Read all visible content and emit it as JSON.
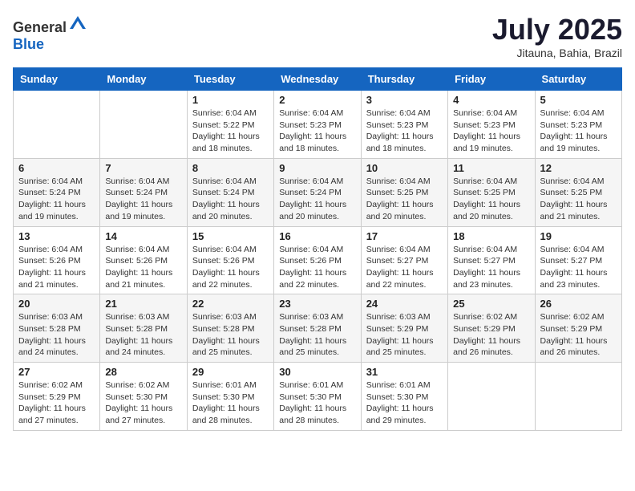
{
  "header": {
    "logo_general": "General",
    "logo_blue": "Blue",
    "month_title": "July 2025",
    "location": "Jitauna, Bahia, Brazil"
  },
  "days_of_week": [
    "Sunday",
    "Monday",
    "Tuesday",
    "Wednesday",
    "Thursday",
    "Friday",
    "Saturday"
  ],
  "weeks": [
    [
      {
        "day": "",
        "sunrise": "",
        "sunset": "",
        "daylight": ""
      },
      {
        "day": "",
        "sunrise": "",
        "sunset": "",
        "daylight": ""
      },
      {
        "day": "1",
        "sunrise": "Sunrise: 6:04 AM",
        "sunset": "Sunset: 5:22 PM",
        "daylight": "Daylight: 11 hours and 18 minutes."
      },
      {
        "day": "2",
        "sunrise": "Sunrise: 6:04 AM",
        "sunset": "Sunset: 5:23 PM",
        "daylight": "Daylight: 11 hours and 18 minutes."
      },
      {
        "day": "3",
        "sunrise": "Sunrise: 6:04 AM",
        "sunset": "Sunset: 5:23 PM",
        "daylight": "Daylight: 11 hours and 18 minutes."
      },
      {
        "day": "4",
        "sunrise": "Sunrise: 6:04 AM",
        "sunset": "Sunset: 5:23 PM",
        "daylight": "Daylight: 11 hours and 19 minutes."
      },
      {
        "day": "5",
        "sunrise": "Sunrise: 6:04 AM",
        "sunset": "Sunset: 5:23 PM",
        "daylight": "Daylight: 11 hours and 19 minutes."
      }
    ],
    [
      {
        "day": "6",
        "sunrise": "Sunrise: 6:04 AM",
        "sunset": "Sunset: 5:24 PM",
        "daylight": "Daylight: 11 hours and 19 minutes."
      },
      {
        "day": "7",
        "sunrise": "Sunrise: 6:04 AM",
        "sunset": "Sunset: 5:24 PM",
        "daylight": "Daylight: 11 hours and 19 minutes."
      },
      {
        "day": "8",
        "sunrise": "Sunrise: 6:04 AM",
        "sunset": "Sunset: 5:24 PM",
        "daylight": "Daylight: 11 hours and 20 minutes."
      },
      {
        "day": "9",
        "sunrise": "Sunrise: 6:04 AM",
        "sunset": "Sunset: 5:24 PM",
        "daylight": "Daylight: 11 hours and 20 minutes."
      },
      {
        "day": "10",
        "sunrise": "Sunrise: 6:04 AM",
        "sunset": "Sunset: 5:25 PM",
        "daylight": "Daylight: 11 hours and 20 minutes."
      },
      {
        "day": "11",
        "sunrise": "Sunrise: 6:04 AM",
        "sunset": "Sunset: 5:25 PM",
        "daylight": "Daylight: 11 hours and 20 minutes."
      },
      {
        "day": "12",
        "sunrise": "Sunrise: 6:04 AM",
        "sunset": "Sunset: 5:25 PM",
        "daylight": "Daylight: 11 hours and 21 minutes."
      }
    ],
    [
      {
        "day": "13",
        "sunrise": "Sunrise: 6:04 AM",
        "sunset": "Sunset: 5:26 PM",
        "daylight": "Daylight: 11 hours and 21 minutes."
      },
      {
        "day": "14",
        "sunrise": "Sunrise: 6:04 AM",
        "sunset": "Sunset: 5:26 PM",
        "daylight": "Daylight: 11 hours and 21 minutes."
      },
      {
        "day": "15",
        "sunrise": "Sunrise: 6:04 AM",
        "sunset": "Sunset: 5:26 PM",
        "daylight": "Daylight: 11 hours and 22 minutes."
      },
      {
        "day": "16",
        "sunrise": "Sunrise: 6:04 AM",
        "sunset": "Sunset: 5:26 PM",
        "daylight": "Daylight: 11 hours and 22 minutes."
      },
      {
        "day": "17",
        "sunrise": "Sunrise: 6:04 AM",
        "sunset": "Sunset: 5:27 PM",
        "daylight": "Daylight: 11 hours and 22 minutes."
      },
      {
        "day": "18",
        "sunrise": "Sunrise: 6:04 AM",
        "sunset": "Sunset: 5:27 PM",
        "daylight": "Daylight: 11 hours and 23 minutes."
      },
      {
        "day": "19",
        "sunrise": "Sunrise: 6:04 AM",
        "sunset": "Sunset: 5:27 PM",
        "daylight": "Daylight: 11 hours and 23 minutes."
      }
    ],
    [
      {
        "day": "20",
        "sunrise": "Sunrise: 6:03 AM",
        "sunset": "Sunset: 5:28 PM",
        "daylight": "Daylight: 11 hours and 24 minutes."
      },
      {
        "day": "21",
        "sunrise": "Sunrise: 6:03 AM",
        "sunset": "Sunset: 5:28 PM",
        "daylight": "Daylight: 11 hours and 24 minutes."
      },
      {
        "day": "22",
        "sunrise": "Sunrise: 6:03 AM",
        "sunset": "Sunset: 5:28 PM",
        "daylight": "Daylight: 11 hours and 25 minutes."
      },
      {
        "day": "23",
        "sunrise": "Sunrise: 6:03 AM",
        "sunset": "Sunset: 5:28 PM",
        "daylight": "Daylight: 11 hours and 25 minutes."
      },
      {
        "day": "24",
        "sunrise": "Sunrise: 6:03 AM",
        "sunset": "Sunset: 5:29 PM",
        "daylight": "Daylight: 11 hours and 25 minutes."
      },
      {
        "day": "25",
        "sunrise": "Sunrise: 6:02 AM",
        "sunset": "Sunset: 5:29 PM",
        "daylight": "Daylight: 11 hours and 26 minutes."
      },
      {
        "day": "26",
        "sunrise": "Sunrise: 6:02 AM",
        "sunset": "Sunset: 5:29 PM",
        "daylight": "Daylight: 11 hours and 26 minutes."
      }
    ],
    [
      {
        "day": "27",
        "sunrise": "Sunrise: 6:02 AM",
        "sunset": "Sunset: 5:29 PM",
        "daylight": "Daylight: 11 hours and 27 minutes."
      },
      {
        "day": "28",
        "sunrise": "Sunrise: 6:02 AM",
        "sunset": "Sunset: 5:30 PM",
        "daylight": "Daylight: 11 hours and 27 minutes."
      },
      {
        "day": "29",
        "sunrise": "Sunrise: 6:01 AM",
        "sunset": "Sunset: 5:30 PM",
        "daylight": "Daylight: 11 hours and 28 minutes."
      },
      {
        "day": "30",
        "sunrise": "Sunrise: 6:01 AM",
        "sunset": "Sunset: 5:30 PM",
        "daylight": "Daylight: 11 hours and 28 minutes."
      },
      {
        "day": "31",
        "sunrise": "Sunrise: 6:01 AM",
        "sunset": "Sunset: 5:30 PM",
        "daylight": "Daylight: 11 hours and 29 minutes."
      },
      {
        "day": "",
        "sunrise": "",
        "sunset": "",
        "daylight": ""
      },
      {
        "day": "",
        "sunrise": "",
        "sunset": "",
        "daylight": ""
      }
    ]
  ]
}
